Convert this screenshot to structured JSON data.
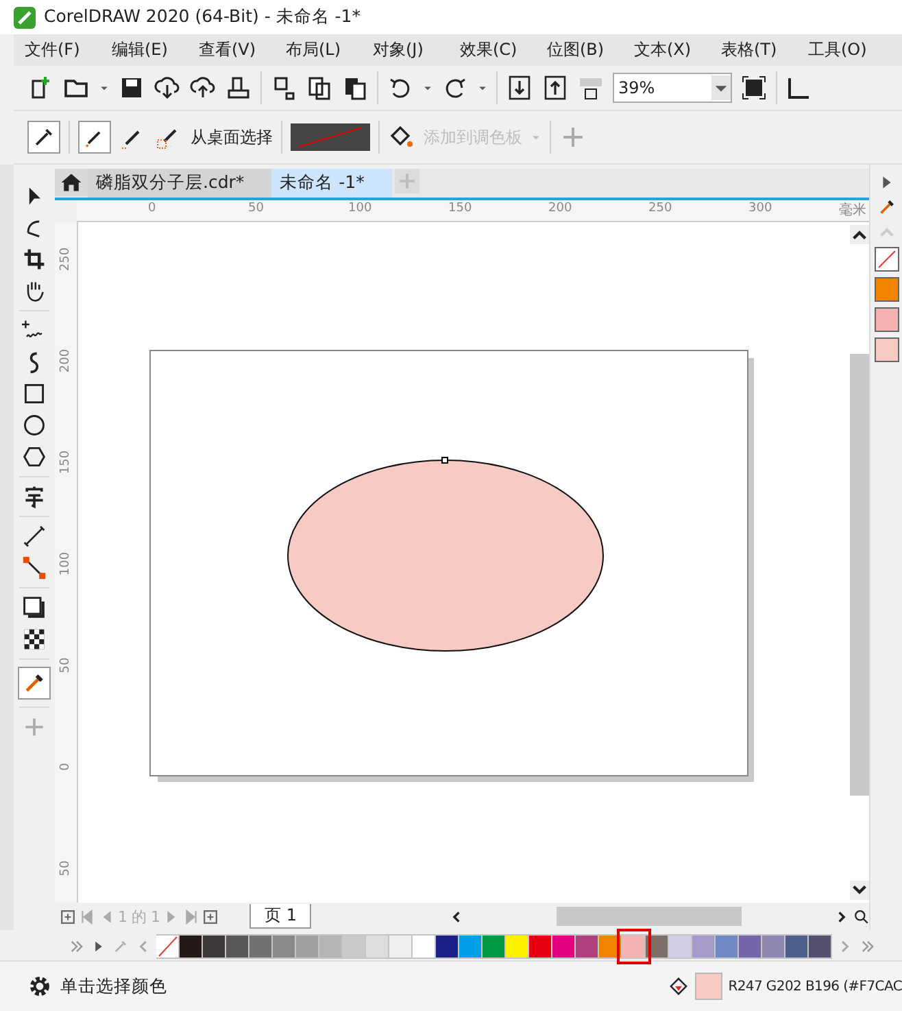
{
  "window": {
    "title": "CorelDRAW 2020 (64-Bit) - 未命名 -1*"
  },
  "menu": [
    "文件(F)",
    "编辑(E)",
    "查看(V)",
    "布局(L)",
    "对象(J)",
    "效果(C)",
    "位图(B)",
    "文本(X)",
    "表格(T)",
    "工具(O)"
  ],
  "toolbar": {
    "zoom": "39%"
  },
  "property_bar": {
    "desktop_pick": "从桌面选择",
    "add_to_palette": {
      "label": "添加到调色板",
      "disabled": true
    }
  },
  "tabs": [
    {
      "label": "磷脂双分子层.cdr*",
      "selected": false
    },
    {
      "label": "未命名 -1*",
      "selected": true
    }
  ],
  "ruler": {
    "h_ticks": [
      "0",
      "50",
      "100",
      "150",
      "200",
      "250",
      "300"
    ],
    "unit": "毫米",
    "v_ticks": [
      "250",
      "200",
      "150",
      "100",
      "50",
      "0",
      "50"
    ]
  },
  "page_nav": {
    "current": "1",
    "of": "的",
    "total": "1",
    "page_tab": "页 1"
  },
  "palette": [
    {
      "kind": "none",
      "selected": false
    },
    {
      "color": "#231815",
      "selected": false
    },
    {
      "color": "#3e3a39",
      "selected": false
    },
    {
      "color": "#595757",
      "selected": false
    },
    {
      "color": "#727171",
      "selected": false
    },
    {
      "color": "#898989",
      "selected": false
    },
    {
      "color": "#9fa0a0",
      "selected": false
    },
    {
      "color": "#b5b5b6",
      "selected": false
    },
    {
      "color": "#c9caca",
      "selected": false
    },
    {
      "color": "#dcdddd",
      "selected": false
    },
    {
      "color": "#efefef",
      "selected": false
    },
    {
      "color": "#ffffff",
      "selected": false
    },
    {
      "color": "#1d2088",
      "selected": false
    },
    {
      "color": "#00a0e9",
      "selected": false
    },
    {
      "color": "#009944",
      "selected": false
    },
    {
      "color": "#fff100",
      "selected": false
    },
    {
      "color": "#e60012",
      "selected": false
    },
    {
      "color": "#e4007f",
      "selected": false
    },
    {
      "color": "#b0427f",
      "selected": false
    },
    {
      "color": "#f08300",
      "selected": false
    },
    {
      "color": "#f5b2b2",
      "selected": true
    },
    {
      "color": "#7d6e68",
      "selected": false
    },
    {
      "color": "#d2cce4",
      "selected": false
    },
    {
      "color": "#a59aca",
      "selected": false
    },
    {
      "color": "#7188c4",
      "selected": false
    },
    {
      "color": "#7464aa",
      "selected": false
    },
    {
      "color": "#8e86b1",
      "selected": false
    },
    {
      "color": "#4e5e8a",
      "selected": false
    },
    {
      "color": "#534f6f",
      "selected": false
    }
  ],
  "docker_swatches": [
    {
      "kind": "none"
    },
    {
      "color": "#f08300"
    },
    {
      "color": "#f5b2b2"
    },
    {
      "color": "#f7cac4"
    }
  ],
  "status": {
    "hint": "单击选择颜色",
    "fill_swatch": {
      "color": "#f7cac4"
    },
    "readout": "R247 G202 B196 (#F7CAC"
  }
}
